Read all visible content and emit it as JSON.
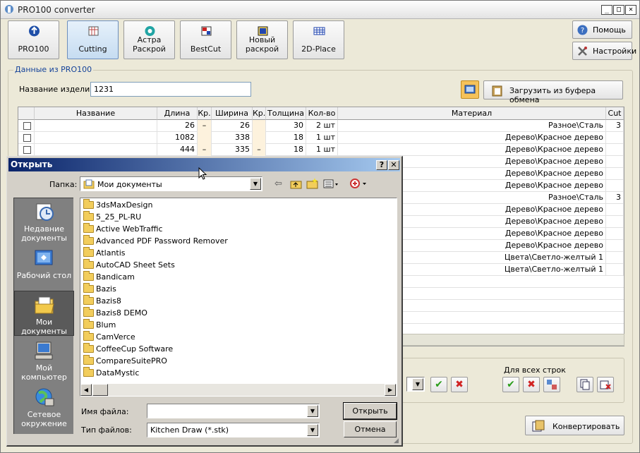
{
  "app": {
    "title": "PRO100 converter"
  },
  "toolbar": [
    {
      "label": "PRO100",
      "icon": "upload-arrow-icon"
    },
    {
      "label": "Cutting",
      "icon": "cutting-icon"
    },
    {
      "label": "Астра\nРаскрой",
      "icon": "astra-icon"
    },
    {
      "label": "BestCut",
      "icon": "bestcut-icon"
    },
    {
      "label": "Новый\nраскрой",
      "icon": "new-cutting-icon"
    },
    {
      "label": "2D-Place",
      "icon": "grid-icon"
    }
  ],
  "side": {
    "help": "Помощь",
    "settings": "Настройки"
  },
  "group": {
    "title": "Данные из PRO100",
    "name_label": "Название изделия:",
    "name_value": "1231",
    "clipboard_btn": "Загрузить из буфера обмена"
  },
  "table": {
    "headers": [
      "",
      "Название",
      "Длина",
      "Кр.",
      "Ширина",
      "Кр.",
      "Толщина",
      "Кол-во",
      "Материал",
      "Cut"
    ],
    "rows": [
      {
        "len": "26",
        "kr1": "–",
        "wid": "26",
        "kr2": "",
        "thk": "30",
        "qty": "2 шт",
        "mat": "Разное\\Сталь",
        "cut": "3"
      },
      {
        "len": "1082",
        "kr1": "",
        "wid": "338",
        "kr2": "",
        "thk": "18",
        "qty": "1 шт",
        "mat": "Дерево\\Красное дерево",
        "cut": ""
      },
      {
        "len": "444",
        "kr1": "–",
        "wid": "335",
        "kr2": "–",
        "thk": "18",
        "qty": "1 шт",
        "mat": "Дерево\\Красное дерево",
        "cut": ""
      },
      {
        "mat": "Дерево\\Красное дерево",
        "cut": ""
      },
      {
        "mat": "Дерево\\Красное дерево",
        "cut": ""
      },
      {
        "mat": "Дерево\\Красное дерево",
        "cut": ""
      },
      {
        "mat": "Разное\\Сталь",
        "cut": "3"
      },
      {
        "mat": "Дерево\\Красное дерево",
        "cut": ""
      },
      {
        "mat": "Дерево\\Красное дерево",
        "cut": ""
      },
      {
        "mat": "Дерево\\Красное дерево",
        "cut": ""
      },
      {
        "mat": "Дерево\\Красное дерево",
        "cut": ""
      },
      {
        "mat": "Цвета\\Светло-желтый 1",
        "cut": ""
      },
      {
        "mat": "Цвета\\Светло-желтый 1",
        "cut": ""
      }
    ]
  },
  "bottom": {
    "all_rows": "Для всех строк",
    "convert": "Конвертировать"
  },
  "dialog": {
    "title": "Открыть",
    "help": "?",
    "close": "✕",
    "folder_label": "Папка:",
    "folder_value": "Мои документы",
    "places": [
      "Недавние\nдокументы",
      "Рабочий стол",
      "Мои\nдокументы",
      "Мой\nкомпьютер",
      "Сетевое\nокружение"
    ],
    "files": [
      "3dsMaxDesign",
      "5_25_PL-RU",
      "Active WebTraffic",
      "Advanced PDF Password Remover",
      "Atlantis",
      "AutoCAD Sheet Sets",
      "Bandicam",
      "Bazis",
      "Bazis8",
      "Bazis8 DEMO",
      "Blum",
      "CamVerce",
      "CoffeeCup Software",
      "CompareSuitePRO",
      "DataMystic"
    ],
    "filename_label": "Имя файла:",
    "filename_value": "",
    "filetype_label": "Тип файлов:",
    "filetype_value": "Kitchen Draw (*.stk)",
    "open": "Открыть",
    "cancel": "Отмена"
  }
}
